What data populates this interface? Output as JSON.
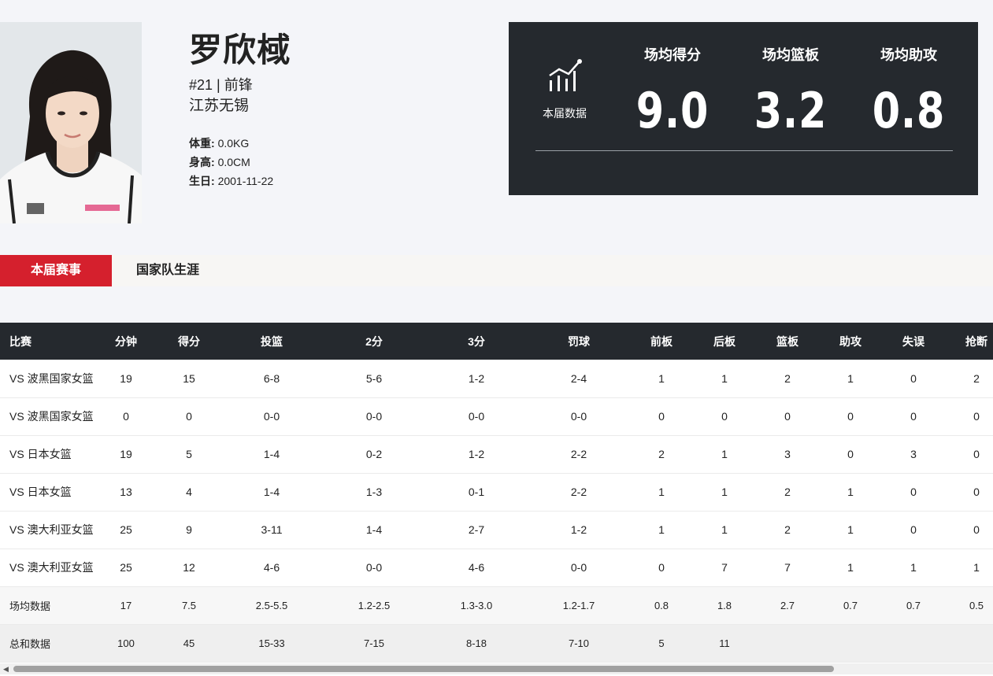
{
  "player": {
    "name": "罗欣棫",
    "number_position": "#21 | 前锋",
    "team": "江苏无锡",
    "weight_label": "体重:",
    "weight": "0.0KG",
    "height_label": "身高:",
    "height": "0.0CM",
    "birth_label": "生日:",
    "birth": "2001-11-22"
  },
  "season_stats": {
    "icon": "stats-chart-icon",
    "label": "本届数据",
    "items": [
      {
        "title": "场均得分",
        "value": "9.0"
      },
      {
        "title": "场均篮板",
        "value": "3.2"
      },
      {
        "title": "场均助攻",
        "value": "0.8"
      }
    ]
  },
  "tabs": [
    {
      "label": "本届赛事",
      "active": true
    },
    {
      "label": "国家队生涯",
      "active": false
    }
  ],
  "table": {
    "headers": [
      "比赛",
      "分钟",
      "得分",
      "投篮",
      "2分",
      "3分",
      "罚球",
      "前板",
      "后板",
      "篮板",
      "助攻",
      "失误",
      "抢断"
    ],
    "rows": [
      [
        "VS 波黑国家女篮",
        "19",
        "15",
        "6-8",
        "5-6",
        "1-2",
        "2-4",
        "1",
        "1",
        "2",
        "1",
        "0",
        "2"
      ],
      [
        "VS 波黑国家女篮",
        "0",
        "0",
        "0-0",
        "0-0",
        "0-0",
        "0-0",
        "0",
        "0",
        "0",
        "0",
        "0",
        "0"
      ],
      [
        "VS 日本女篮",
        "19",
        "5",
        "1-4",
        "0-2",
        "1-2",
        "2-2",
        "2",
        "1",
        "3",
        "0",
        "3",
        "0"
      ],
      [
        "VS 日本女篮",
        "13",
        "4",
        "1-4",
        "1-3",
        "0-1",
        "2-2",
        "1",
        "1",
        "2",
        "1",
        "0",
        "0"
      ],
      [
        "VS 澳大利亚女篮",
        "25",
        "9",
        "3-11",
        "1-4",
        "2-7",
        "1-2",
        "1",
        "1",
        "2",
        "1",
        "0",
        "0"
      ],
      [
        "VS 澳大利亚女篮",
        "25",
        "12",
        "4-6",
        "0-0",
        "4-6",
        "0-0",
        "0",
        "7",
        "7",
        "1",
        "1",
        "1"
      ]
    ],
    "average": [
      "场均数据",
      "17",
      "7.5",
      "2.5-5.5",
      "1.2-2.5",
      "1.3-3.0",
      "1.2-1.7",
      "0.8",
      "1.8",
      "2.7",
      "0.7",
      "0.7",
      "0.5"
    ],
    "total": [
      "总和数据",
      "100",
      "45",
      "15-33",
      "7-15",
      "8-18",
      "7-10",
      "5",
      "11",
      "",
      "",
      "",
      ""
    ]
  },
  "colors": {
    "accent": "#d5202d",
    "dark_panel": "#25292e",
    "page_bg": "#f4f5f9"
  }
}
